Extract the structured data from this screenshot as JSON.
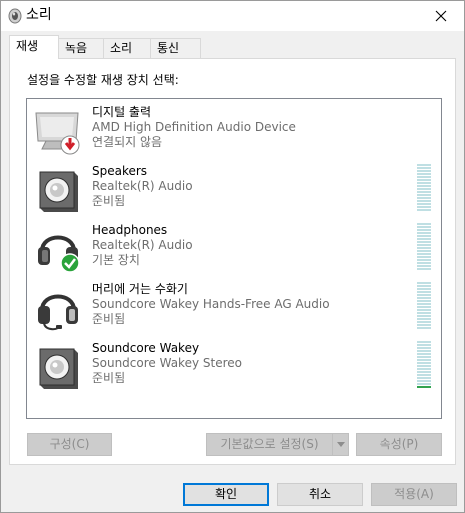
{
  "window": {
    "title": "소리"
  },
  "tabs": [
    {
      "label": "재생"
    },
    {
      "label": "녹음"
    },
    {
      "label": "소리"
    },
    {
      "label": "통신"
    }
  ],
  "instruction": "설정을 수정할 재생 장치 선택:",
  "devices": [
    {
      "name": "디지털 출력",
      "sub": "AMD High Definition Audio Device",
      "status": "연결되지 않음",
      "icon": "monitor-icon",
      "badge": "disconnected-badge-icon",
      "level": 0
    },
    {
      "name": "Speakers",
      "sub": "Realtek(R) Audio",
      "status": "준비됨",
      "icon": "speaker-icon",
      "level": 0
    },
    {
      "name": "Headphones",
      "sub": "Realtek(R) Audio",
      "status": "기본 장치",
      "icon": "headphones-icon",
      "badge": "default-check-badge-icon",
      "level": 0
    },
    {
      "name": "머리에 거는 수화기",
      "sub": "Soundcore Wakey Hands-Free AG Audio",
      "status": "준비됨",
      "icon": "headset-icon",
      "level": 0
    },
    {
      "name": "Soundcore Wakey",
      "sub": "Soundcore Wakey Stereo",
      "status": "준비됨",
      "icon": "speaker-icon",
      "level": 0.08
    }
  ],
  "buttons": {
    "configure": "구성(C)",
    "set_default": "기본값으로 설정(S)",
    "properties": "속성(P)",
    "ok": "확인",
    "cancel": "취소",
    "apply": "적용(A)"
  },
  "colors": {
    "accent": "#0078d7",
    "meter_idle": "#bfdfe3",
    "meter_active": "#31a34f",
    "secondary_text": "#6d6d6d"
  }
}
